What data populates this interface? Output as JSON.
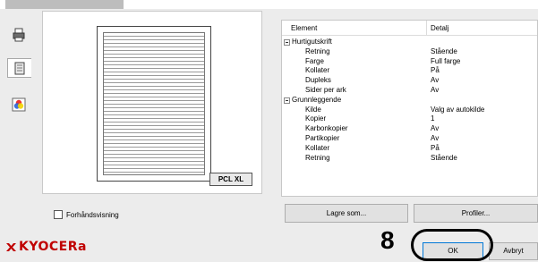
{
  "side_icons": [
    "printer-icon",
    "document-icon",
    "color-icon"
  ],
  "preview": {
    "badge": "PCL XL"
  },
  "tree": {
    "columns": {
      "element": "Element",
      "detail": "Detalj"
    },
    "rows": [
      {
        "type": "group",
        "element": "Hurtigutskrift",
        "value": ""
      },
      {
        "type": "item",
        "element": "Retning",
        "value": "Stående"
      },
      {
        "type": "item",
        "element": "Farge",
        "value": "Full farge"
      },
      {
        "type": "item",
        "element": "Kollater",
        "value": "På"
      },
      {
        "type": "item",
        "element": "Dupleks",
        "value": "Av"
      },
      {
        "type": "item",
        "element": "Sider per ark",
        "value": "Av"
      },
      {
        "type": "group",
        "element": "Grunnleggende",
        "value": ""
      },
      {
        "type": "item",
        "element": "Kilde",
        "value": "Valg av autokilde"
      },
      {
        "type": "item",
        "element": "Kopier",
        "value": "1"
      },
      {
        "type": "item",
        "element": "Karbonkopier",
        "value": "Av"
      },
      {
        "type": "item",
        "element": "Partikopier",
        "value": "Av"
      },
      {
        "type": "item",
        "element": "Kollater",
        "value": "På"
      },
      {
        "type": "item",
        "element": "Retning",
        "value": "Stående"
      }
    ]
  },
  "preview_checkbox": {
    "label": "Forhåndsvisning",
    "checked": false
  },
  "buttons": {
    "save_as": "Lagre som...",
    "profiles": "Profiler...",
    "ok": "OK",
    "cancel": "Avbryt"
  },
  "brand": {
    "logo_text": "KYOCERa",
    "color": "#c00000"
  },
  "annotation": {
    "step_number": "8"
  }
}
